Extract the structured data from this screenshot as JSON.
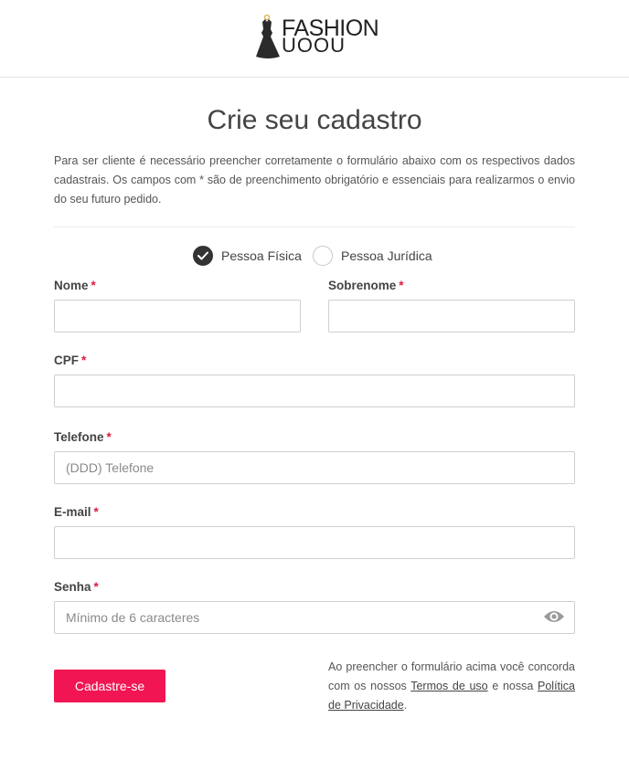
{
  "brand": {
    "top": "FASHION",
    "bottom": "UOOU"
  },
  "page_title": "Crie seu cadastro",
  "intro_text": "Para ser cliente é necessário preencher corretamente o formulário abaixo com os respectivos dados cadastrais. Os campos com * são de preenchimento obrigatório e essenciais para realizarmos o envio do seu futuro pedido.",
  "person_type": {
    "options": [
      "Pessoa Física",
      "Pessoa Jurídica"
    ],
    "selected": "Pessoa Física"
  },
  "form": {
    "required_mark": "*",
    "nome": {
      "label": "Nome",
      "value": ""
    },
    "sobrenome": {
      "label": "Sobrenome",
      "value": ""
    },
    "cpf": {
      "label": "CPF",
      "value": ""
    },
    "telefone": {
      "label": "Telefone",
      "placeholder": "(DDD) Telefone",
      "value": ""
    },
    "email": {
      "label": "E-mail",
      "value": ""
    },
    "senha": {
      "label": "Senha",
      "placeholder": "Mínimo de 6 caracteres",
      "value": ""
    }
  },
  "submit_label": "Cadastre-se",
  "terms": {
    "prefix": "Ao preencher o formulário acima você concorda com os nossos",
    "terms_link": "Termos de uso",
    "middle": "e nossa",
    "privacy_link": "Política de Privacidade",
    "suffix": "."
  },
  "colors": {
    "accent": "#f11653",
    "required": "#e0193f",
    "text": "#444444"
  },
  "icons": {
    "logo": "dress-icon",
    "checked": "check-icon",
    "password_toggle": "eye-icon"
  }
}
